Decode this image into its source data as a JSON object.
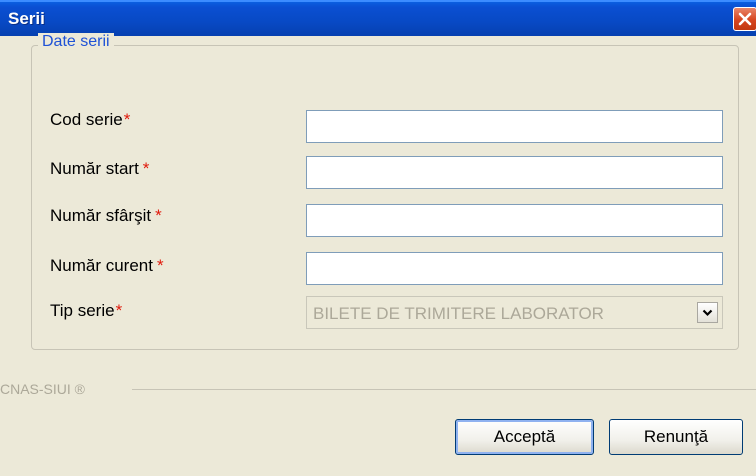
{
  "window": {
    "title": "Serii",
    "close_icon": "close-icon"
  },
  "group": {
    "legend": "Date serii"
  },
  "fields": [
    {
      "label": "Cod serie",
      "required_mark": "*",
      "value": ""
    },
    {
      "label": "Număr start",
      "required_mark": "*",
      "value": ""
    },
    {
      "label": "Număr sfârşit",
      "required_mark": "*",
      "value": ""
    },
    {
      "label": "Număr curent",
      "required_mark": "*",
      "value": ""
    }
  ],
  "tip_serie": {
    "label": "Tip serie",
    "required_mark": "*",
    "selected": "BILETE DE TRIMITERE LABORATOR",
    "arrow_icon": "chevron-down-icon"
  },
  "footer": {
    "brand": "CNAS-SIUI ®"
  },
  "buttons": {
    "accept": "Acceptă",
    "cancel": "Renunţă"
  },
  "colors": {
    "title_bar": "#0a4fd2",
    "required": "#e0190b",
    "legend": "#1f52d6",
    "disabled_text": "#aca899"
  }
}
